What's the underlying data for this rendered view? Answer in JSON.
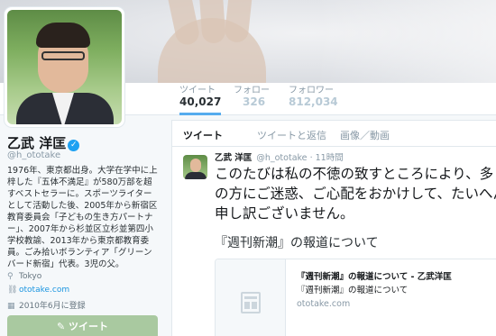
{
  "profile": {
    "name": "乙武 洋匡",
    "handle": "@h_ototake",
    "bio": "1976年、東京都出身。大学在学中に上梓した『五体不満足』が580万部を超すベストセラーに。スポーツライターとして活動した後、2005年から新宿区教育委員会「子どもの生き方パートナー」、2007年から杉並区立杉並第四小学校教諭、2013年から東京都教育委員。ごみ拾いボランティア「グリーンバード新宿」代表。3児の父。",
    "location": "Tokyo",
    "website": "ototake.com",
    "joined": "2010年6月に登録",
    "tweet_button": "ツイート"
  },
  "nav": {
    "tweets_label": "ツイート",
    "tweets_count": "40,027",
    "following_label": "フォロー",
    "following_count": "326",
    "followers_label": "フォロワー",
    "followers_count": "812,034"
  },
  "tabs": [
    "ツイート",
    "ツイートと返信",
    "画像／動画"
  ],
  "tweet": {
    "name": "乙武 洋匡",
    "handle": "@h_ototake",
    "separator": "·",
    "time": "11時間",
    "text": "このたびは私の不徳の致すところにより、多くの方にご迷惑、ご心配をおかけして、たいへん申し訳ございません。",
    "title": "『週刊新潮』の報道について",
    "card": {
      "title": "『週刊新潮』の報道について - 乙武洋匡",
      "description": "『週刊新潮』の報道について",
      "domain": "ototake.com"
    }
  },
  "colors": {
    "accent": "#55acee",
    "verified": "#1da1f2",
    "tweet_button": "#a9c9a0"
  },
  "icons": {
    "verified": "check-badge-icon",
    "location": "pin-icon",
    "link": "link-icon",
    "calendar": "calendar-icon",
    "card_placeholder": "document-icon",
    "compose": "pencil-icon"
  }
}
